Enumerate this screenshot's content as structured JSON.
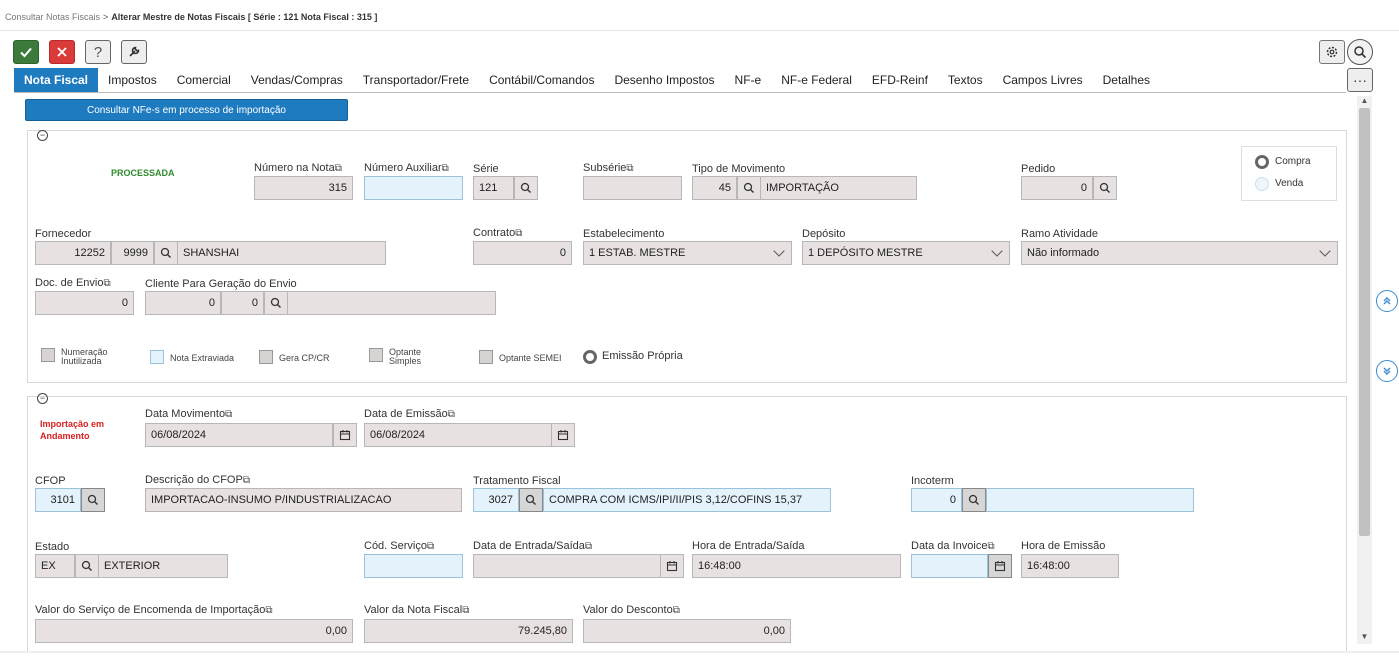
{
  "breadcrumb": {
    "parent": "Consultar Notas Fiscais",
    "separator": ">",
    "current": "Alterar Mestre de Notas Fiscais [ Série : 121 Nota Fiscal : 315 ]"
  },
  "toolbar": {
    "help_label": "?"
  },
  "more_label": "···",
  "tabs": [
    "Nota Fiscal",
    "Impostos",
    "Comercial",
    "Vendas/Compras",
    "Transportador/Frete",
    "Contábil/Comandos",
    "Desenho Impostos",
    "NF-e",
    "NF-e Federal",
    "EFD-Reinf",
    "Textos",
    "Campos Livres",
    "Detalhes"
  ],
  "import_button": "Consultar NFe-s em processo de importação",
  "section1": {
    "status": "PROCESSADA",
    "numero_nota": {
      "label": "Número na Nota",
      "value": "315"
    },
    "numero_auxiliar": {
      "label": "Número Auxiliar",
      "value": ""
    },
    "serie": {
      "label": "Série",
      "value": "121"
    },
    "subserie": {
      "label": "Subsérie",
      "value": ""
    },
    "tipo_movimento": {
      "label": "Tipo de Movimento",
      "code": "45",
      "desc": "IMPORTAÇÃO"
    },
    "pedido": {
      "label": "Pedido",
      "value": "0"
    },
    "radio": {
      "compra": "Compra",
      "venda": "Venda"
    },
    "fornecedor": {
      "label": "Fornecedor",
      "code1": "12252",
      "code2": "9999",
      "name": "SHANSHAI"
    },
    "contrato": {
      "label": "Contrato",
      "value": "0"
    },
    "estabelecimento": {
      "label": "Estabelecimento",
      "value": "1 ESTAB. MESTRE"
    },
    "deposito": {
      "label": "Depósito",
      "value": "1 DEPÓSITO MESTRE"
    },
    "ramo": {
      "label": "Ramo Atividade",
      "value": "Não informado"
    },
    "doc_envio": {
      "label": "Doc. de Envio",
      "value": "0"
    },
    "cliente_envio": {
      "label": "Cliente Para Geração do Envio",
      "v1": "0",
      "v2": "0",
      "v3": ""
    },
    "checks": {
      "numeracao1": "Numeração",
      "numeracao2": "Inutilizada",
      "extraviada": "Nota Extraviada",
      "gera": "Gera CP/CR",
      "optante1": "Optante",
      "optante2": "Simples",
      "semei": "Optante SEMEI",
      "emissao": "Emissão Própria"
    }
  },
  "section2": {
    "status": "Importação em Andamento",
    "data_mov": {
      "label": "Data Movimento",
      "value": "06/08/2024"
    },
    "data_emissao": {
      "label": "Data de Emissão",
      "value": "06/08/2024"
    },
    "cfop": {
      "label": "CFOP",
      "value": "3101"
    },
    "desc_cfop": {
      "label": "Descrição do CFOP",
      "value": "IMPORTACAO-INSUMO P/INDUSTRIALIZACAO"
    },
    "tratamento": {
      "label": "Tratamento Fiscal",
      "code": "3027",
      "desc": "COMPRA COM ICMS/IPI/II/PIS 3,12/COFINS 15,37"
    },
    "incoterm": {
      "label": "Incoterm",
      "code": "0",
      "desc": ""
    },
    "estado": {
      "label": "Estado",
      "code": "EX",
      "desc": "EXTERIOR"
    },
    "cod_servico": {
      "label": "Cód. Serviço",
      "value": ""
    },
    "data_entrada": {
      "label": "Data de Entrada/Saída",
      "value": ""
    },
    "hora_entrada": {
      "label": "Hora de Entrada/Saída",
      "value": "16:48:00"
    },
    "data_invoice": {
      "label": "Data da Invoice",
      "value": ""
    },
    "hora_emissao": {
      "label": "Hora de Emissão",
      "value": "16:48:00"
    },
    "valor_servico": {
      "label": "Valor do Serviço de Encomenda de Importação",
      "value": "0,00"
    },
    "valor_nota": {
      "label": "Valor da Nota Fiscal",
      "value": "79.245,80"
    },
    "valor_desconto": {
      "label": "Valor do Desconto",
      "value": "0,00"
    }
  }
}
